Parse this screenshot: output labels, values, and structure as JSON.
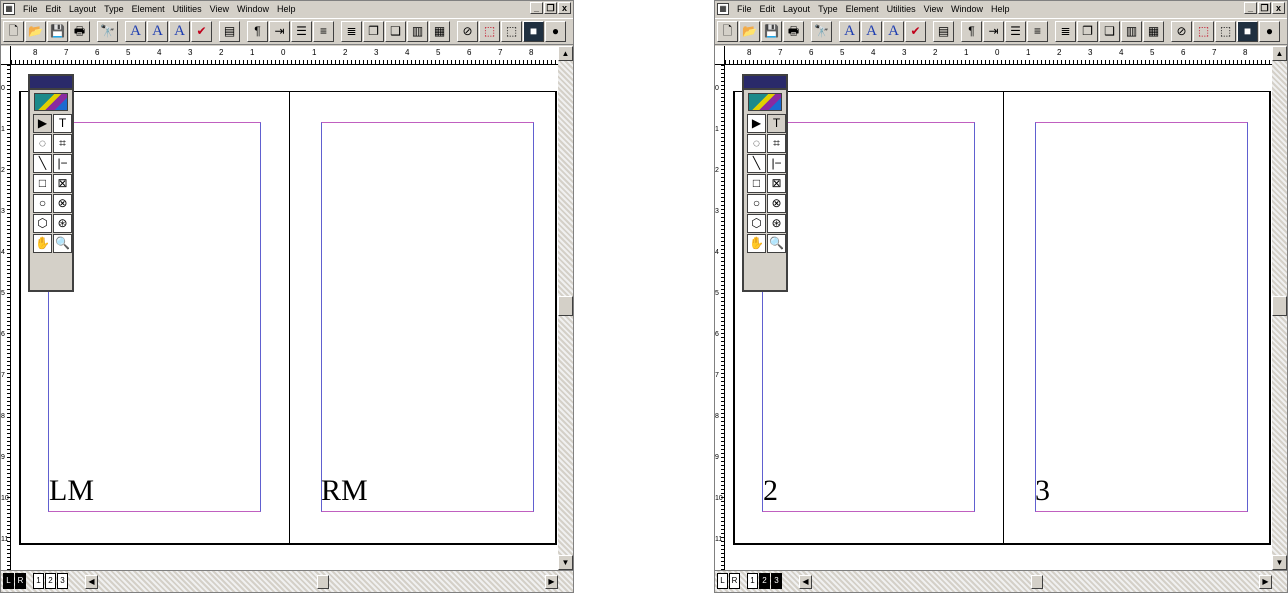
{
  "menu": {
    "sys_icon": "▦",
    "items": [
      "File",
      "Edit",
      "Layout",
      "Type",
      "Element",
      "Utilities",
      "View",
      "Window",
      "Help"
    ],
    "controls": [
      "_",
      "❐",
      "x"
    ]
  },
  "toolbar": {
    "icons": [
      "new-icon",
      "open-icon",
      "save-icon",
      "print-icon",
      "find-icon",
      "font-icon",
      "font-up-icon",
      "font-down-icon",
      "spell-icon",
      "story-icon",
      "pilcrow-icon",
      "indent-icon",
      "list-icon",
      "align-left-icon",
      "align-right-icon",
      "copy-icon",
      "paste-icon",
      "frame-icon",
      "table-icon",
      "link-icon",
      "place-icon",
      "export-icon",
      "color-icon",
      "globe-icon",
      "reader-icon",
      "zoom-in-icon",
      "zoom-out-icon"
    ],
    "glyphs": [
      "🗋",
      "📂",
      "💾",
      "🖶",
      "🔭",
      "A",
      "A",
      "A",
      "✔",
      "▤",
      "¶",
      "⇥",
      "☰",
      "≡",
      "≣",
      "❐",
      "❑",
      "▥",
      "▦",
      "⊘",
      "⬚",
      "⬚",
      "■",
      "●",
      "⌥",
      "⊕",
      "⊖"
    ]
  },
  "ruler": {
    "h_ticks": [
      "8",
      "7",
      "6",
      "5",
      "4",
      "3",
      "2",
      "1",
      "0",
      "1",
      "2",
      "3",
      "4",
      "5",
      "6",
      "7",
      "8"
    ],
    "v_ticks": [
      "0",
      "1",
      "2",
      "3",
      "4",
      "5",
      "6",
      "7",
      "8",
      "9",
      "10",
      "11"
    ]
  },
  "toolbox": {
    "tools": [
      "▶",
      "T",
      "◌",
      "⌗",
      "╲",
      "|−",
      "□",
      "⊠",
      "○",
      "⊗",
      "⬡",
      "⊛",
      "✋",
      "🔍"
    ],
    "tool_names": [
      "pointer-icon",
      "text-icon",
      "rotate-icon",
      "crop-icon",
      "line-icon",
      "constrained-line-icon",
      "rectangle-icon",
      "rectangle-frame-icon",
      "ellipse-icon",
      "ellipse-frame-icon",
      "polygon-icon",
      "polygon-frame-icon",
      "hand-icon",
      "zoom-icon"
    ]
  },
  "windows": [
    {
      "page_left_label": "LM",
      "page_right_label": "RM",
      "page_icons": [
        "L",
        "R",
        "1",
        "2",
        "3"
      ],
      "active_pages": [
        0,
        1
      ]
    },
    {
      "page_left_label": "2",
      "page_right_label": "3",
      "page_icons": [
        "L",
        "R",
        "1",
        "2",
        "3"
      ],
      "active_pages": [
        3,
        4
      ]
    }
  ],
  "colors": {
    "chrome": "#d4d0c8",
    "margin_top_bottom": "#c060c0",
    "margin_sides": "#6060d0"
  }
}
